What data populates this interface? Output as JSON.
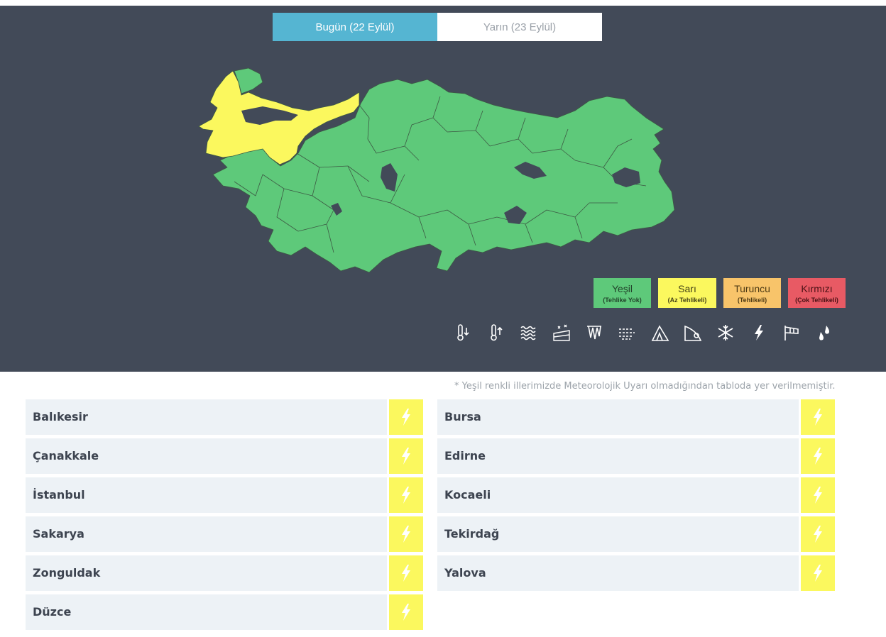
{
  "tabs": [
    {
      "label": "Bugün (22 Eylül)",
      "active": true
    },
    {
      "label": "Yarın (23 Eylül)",
      "active": false
    }
  ],
  "legend": [
    {
      "name": "Yeşil",
      "sub": "(Tehlike Yok)",
      "color": "#5ec97a"
    },
    {
      "name": "Sarı",
      "sub": "(Az Tehlikeli)",
      "color": "#fbf85e"
    },
    {
      "name": "Turuncu",
      "sub": "(Tehlikeli)",
      "color": "#f8c46a"
    },
    {
      "name": "Kırmızı",
      "sub": "(Çok Tehlikeli)",
      "color": "#e85a64"
    }
  ],
  "hazard_icons": [
    "cold-thermometer-icon",
    "hot-thermometer-icon",
    "fog-icon",
    "snow-ice-icon",
    "icing-icon",
    "wind-dust-icon",
    "avalanche-icon",
    "landslide-icon",
    "snowflake-icon",
    "lightning-icon",
    "windsock-icon",
    "rain-drops-icon"
  ],
  "map": {
    "yellow_color": "#fbf85e",
    "green_color": "#5ec97a",
    "background": "#424a58"
  },
  "note": "* Yeşil renkli illerimizde Meteorolojik Uyarı olmadığından tabloda yer verilmemiştir.",
  "warnings": {
    "left": [
      {
        "province": "Balıkesir",
        "icon": "lightning-icon"
      },
      {
        "province": "Çanakkale",
        "icon": "lightning-icon"
      },
      {
        "province": "İstanbul",
        "icon": "lightning-icon"
      },
      {
        "province": "Sakarya",
        "icon": "lightning-icon"
      },
      {
        "province": "Zonguldak",
        "icon": "lightning-icon"
      },
      {
        "province": "Düzce",
        "icon": "lightning-icon"
      }
    ],
    "right": [
      {
        "province": "Bursa",
        "icon": "lightning-icon"
      },
      {
        "province": "Edirne",
        "icon": "lightning-icon"
      },
      {
        "province": "Kocaeli",
        "icon": "lightning-icon"
      },
      {
        "province": "Tekirdağ",
        "icon": "lightning-icon"
      },
      {
        "province": "Yalova",
        "icon": "lightning-icon"
      }
    ],
    "badge_color": "#fbf85e"
  }
}
